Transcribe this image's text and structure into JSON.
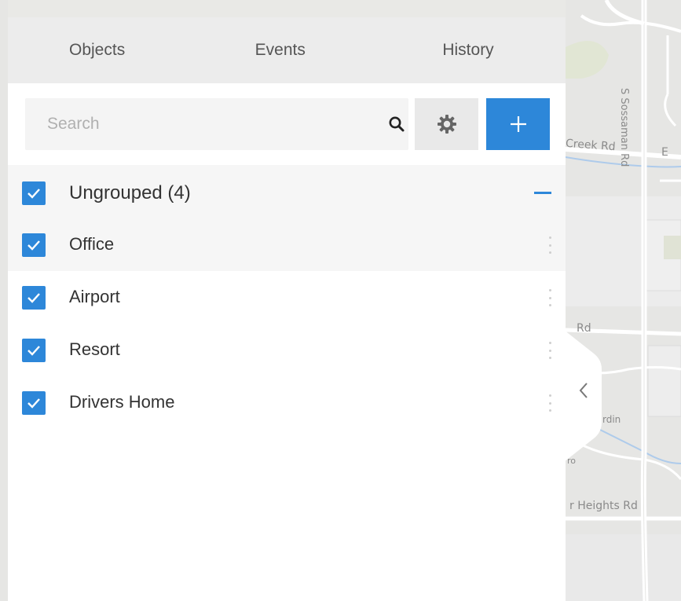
{
  "tabs": [
    {
      "label": "Objects"
    },
    {
      "label": "Events"
    },
    {
      "label": "History"
    }
  ],
  "search": {
    "placeholder": "Search",
    "value": ""
  },
  "toolbar": {
    "search_icon": "search-icon",
    "settings_icon": "gear-icon",
    "add_icon": "plus-icon",
    "accent_color": "#2d87d9"
  },
  "group": {
    "label": "Ungrouped (4)",
    "checked": true
  },
  "items": [
    {
      "label": "Office",
      "checked": true
    },
    {
      "label": "Airport",
      "checked": true
    },
    {
      "label": "Resort",
      "checked": true
    },
    {
      "label": "Drivers Home",
      "checked": true
    }
  ],
  "map": {
    "labels": {
      "creek": "Creek Rd",
      "e": "E",
      "sossaman": "S Sossaman Rd",
      "rd": "Rd",
      "rdin": "rdin",
      "ro": "ro",
      "heights": "r Heights Rd"
    }
  }
}
